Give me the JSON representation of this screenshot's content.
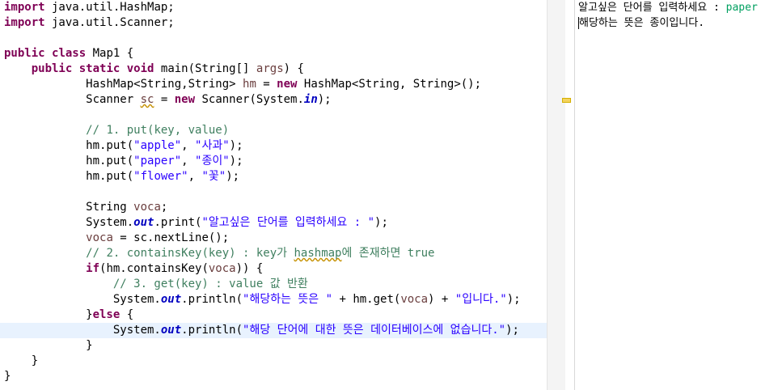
{
  "editor": {
    "lines": [
      [
        "import",
        " java.util.HashMap;"
      ],
      [
        "import",
        " java.util.Scanner;"
      ],
      [],
      [
        "public",
        " ",
        "class",
        " Map1 {"
      ],
      [
        "    ",
        "public",
        " ",
        "static",
        " ",
        "void",
        " main(String[] ",
        "args",
        ") {"
      ],
      [
        "            HashMap<String,String> ",
        "hm",
        " = ",
        "new",
        " HashMap<String, String>();"
      ],
      [
        "            Scanner ",
        "sc",
        " = ",
        "new",
        " Scanner(System.",
        "in",
        ");"
      ],
      [],
      [
        "            ",
        "// 1. put(key, value)"
      ],
      [
        "            hm.put(",
        "\"apple\"",
        ", ",
        "\"사과\"",
        ");"
      ],
      [
        "            hm.put(",
        "\"paper\"",
        ", ",
        "\"종이\"",
        ");"
      ],
      [
        "            hm.put(",
        "\"flower\"",
        ", ",
        "\"꽃\"",
        ");"
      ],
      [],
      [
        "            String ",
        "voca",
        ";"
      ],
      [
        "            System.",
        "out",
        ".print(",
        "\"알고싶은 단어를 입력하세요 : \"",
        ");"
      ],
      [
        "            ",
        "voca",
        " = sc.nextLine();"
      ],
      [
        "            ",
        "// 2. containsKey(key) : key가 ",
        "hashmap",
        "에 존재하면 true"
      ],
      [
        "            ",
        "if",
        "(hm.containsKey(",
        "voca",
        ")) {"
      ],
      [
        "                ",
        "// 3. get(key) : value 값 반환"
      ],
      [
        "                System.",
        "out",
        ".println(",
        "\"해당하는 뜻은 \"",
        " + hm.get(",
        "voca",
        ") + ",
        "\"입니다.\"",
        ");"
      ],
      [
        "            }",
        "else",
        " {"
      ],
      [
        "                System.",
        "out",
        ".println(",
        "\"해당 단어에 대한 뜻은 데이터베이스에 없습니다.\"",
        ");"
      ],
      [
        "            }"
      ],
      [
        "    }"
      ],
      [
        "}"
      ]
    ]
  },
  "console": {
    "prompt": "알고싶은 단어를 입력하세요 : ",
    "input": "paper",
    "output": "해당하는 뜻은 종이입니다."
  }
}
